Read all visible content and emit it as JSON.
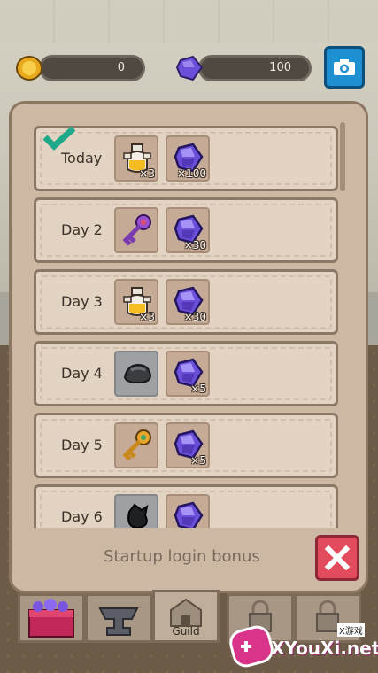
{
  "resources": {
    "coins": {
      "icon": "gold-coin-icon",
      "value": "0"
    },
    "gems": {
      "icon": "purple-gem-icon",
      "value": "100"
    },
    "camera_icon": "camera-icon"
  },
  "login_rewards": [
    {
      "label": "Today",
      "claimed": true,
      "rewards": [
        {
          "icon": "potion-icon",
          "qty": "×3"
        },
        {
          "icon": "purple-gem-icon",
          "qty": "×100"
        }
      ]
    },
    {
      "label": "Day 2",
      "claimed": false,
      "rewards": [
        {
          "icon": "purple-key-icon",
          "qty": ""
        },
        {
          "icon": "purple-gem-icon",
          "qty": "×30"
        }
      ]
    },
    {
      "label": "Day 3",
      "claimed": false,
      "rewards": [
        {
          "icon": "potion-icon",
          "qty": "×3"
        },
        {
          "icon": "purple-gem-icon",
          "qty": "×30"
        }
      ]
    },
    {
      "label": "Day 4",
      "claimed": false,
      "rewards": [
        {
          "icon": "ore-stone-icon",
          "qty": ""
        },
        {
          "icon": "purple-gem-icon",
          "qty": "×5"
        }
      ]
    },
    {
      "label": "Day 5",
      "claimed": false,
      "rewards": [
        {
          "icon": "gold-key-icon",
          "qty": ""
        },
        {
          "icon": "purple-gem-icon",
          "qty": "×5"
        }
      ]
    },
    {
      "label": "Day 6",
      "claimed": false,
      "rewards": [
        {
          "icon": "black-pouch-icon",
          "qty": ""
        },
        {
          "icon": "purple-gem-icon",
          "qty": ""
        }
      ]
    }
  ],
  "panel": {
    "title": "Startup login bonus",
    "close_icon": "close-icon"
  },
  "tabs": [
    {
      "icon": "treasure-chest-icon",
      "label": ""
    },
    {
      "icon": "anvil-icon",
      "label": ""
    },
    {
      "icon": "guild-hall-icon",
      "label": "Guild"
    },
    {
      "icon": "locked-icon",
      "label": ""
    },
    {
      "icon": "locked-icon",
      "label": ""
    }
  ],
  "watermark": {
    "text": "XYouXi.net",
    "small": "X游戏"
  }
}
